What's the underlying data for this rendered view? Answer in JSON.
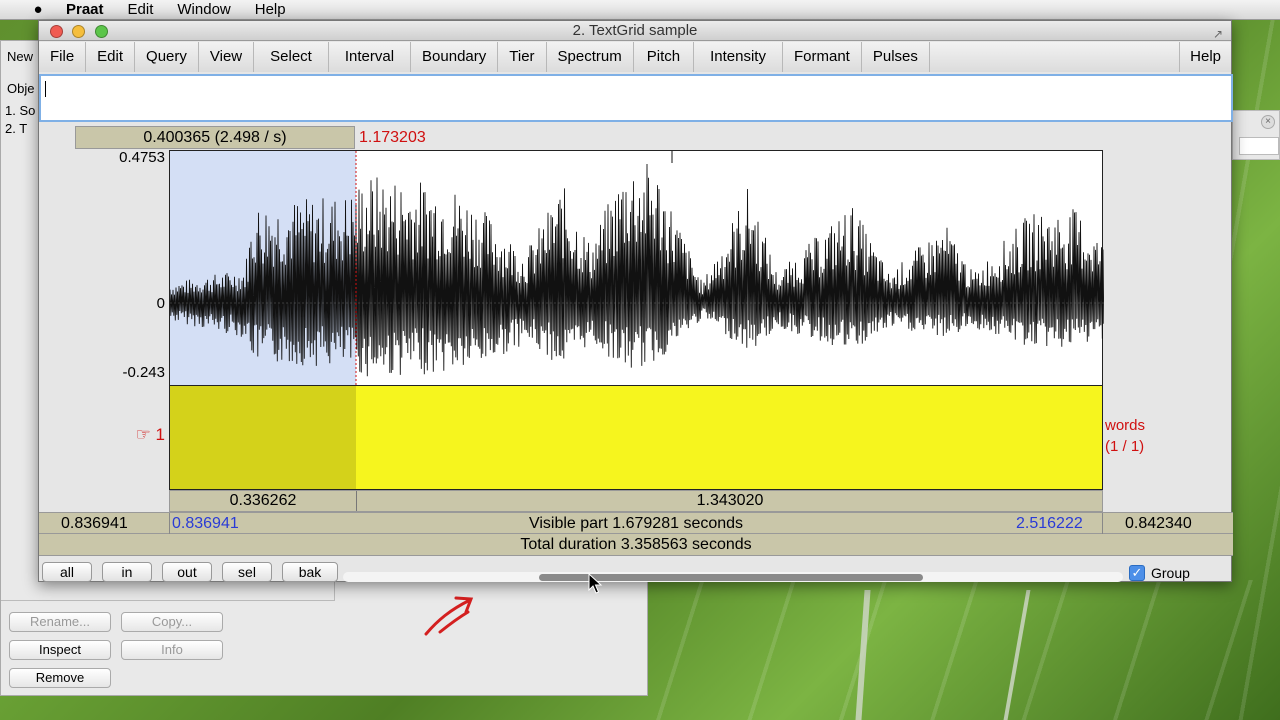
{
  "menubar": {
    "apple": "",
    "items": [
      "Praat",
      "Edit",
      "Window",
      "Help"
    ]
  },
  "object_window": {
    "new_label": "New",
    "objects_label": "Obje",
    "rows": [
      "1. So",
      "2. T"
    ],
    "buttons": {
      "rename": "Rename...",
      "copy": "Copy...",
      "inspect": "Inspect",
      "info": "Info",
      "remove": "Remove"
    }
  },
  "textgrid_window": {
    "title": "2. TextGrid sample",
    "menus": [
      "File",
      "Edit",
      "Query",
      "View",
      "Select",
      "Interval",
      "Boundary",
      "Tier",
      "Spectrum",
      "Pitch",
      "Intensity",
      "Formant",
      "Pulses"
    ],
    "help": "Help",
    "text_value": "",
    "selection_header": "0.400365 (2.498 / s)",
    "cursor_time": "1.173203",
    "y_max": "0.4753",
    "y_zero": "0",
    "y_min": "-0.243",
    "tier_number": "☞ 1",
    "tier_name": "words",
    "tier_count": "(1 / 1)",
    "interval_left_duration": "0.336262",
    "interval_right_duration": "1.343020",
    "left_hidden": "0.836941",
    "visible_start": "0.836941",
    "visible_part": "Visible part 1.679281 seconds",
    "visible_end": "2.516222",
    "right_hidden": "0.842340",
    "total_duration": "Total duration 3.358563 seconds",
    "nav_buttons": [
      "all",
      "in",
      "out",
      "sel",
      "bak"
    ],
    "group_label": "Group",
    "group_checked": true,
    "colors": {
      "selection": "#d4dff5",
      "tier_bg": "#f6f51e",
      "tier_selected": "#d4d21a",
      "cursor_red": "#d01010",
      "blue_time": "#2a3bd6"
    }
  }
}
